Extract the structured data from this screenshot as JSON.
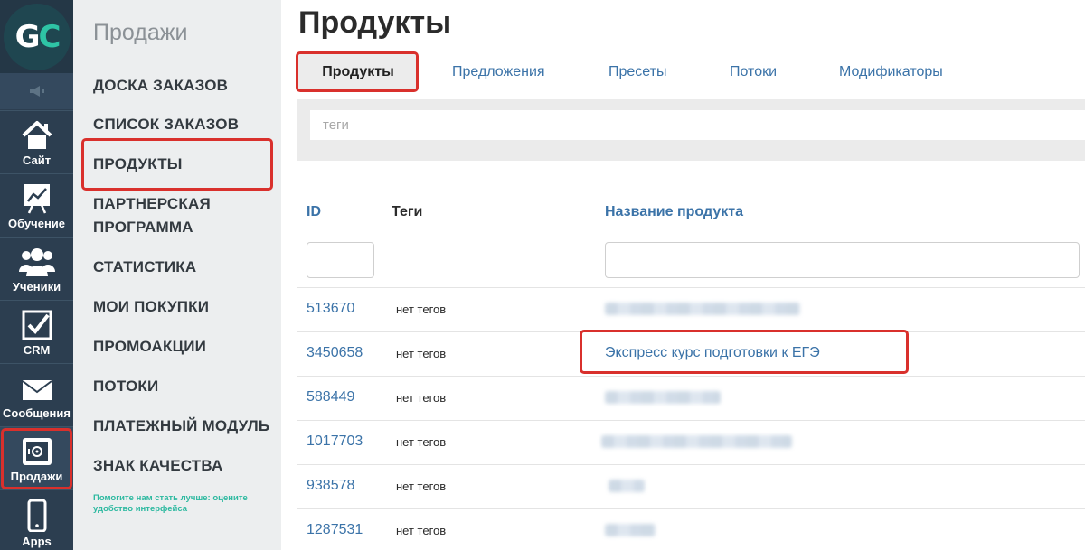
{
  "logo": {
    "g": "G",
    "c": "C"
  },
  "rail": [
    {
      "label": "Сайт",
      "icon": "home-icon"
    },
    {
      "label": "Обучение",
      "icon": "chart-board-icon"
    },
    {
      "label": "Ученики",
      "icon": "users-icon"
    },
    {
      "label": "CRM",
      "icon": "checkbox-icon"
    },
    {
      "label": "Сообщения",
      "icon": "envelope-icon"
    },
    {
      "label": "Продажи",
      "icon": "safe-icon",
      "active": true
    },
    {
      "label": "Apps",
      "icon": "phone-icon"
    }
  ],
  "menu": {
    "title": "Продажи",
    "items": [
      "ДОСКА ЗАКАЗОВ",
      "СПИСОК ЗАКАЗОВ",
      "ПРОДУКТЫ",
      "ПАРТНЕРСКАЯ ПРОГРАММА",
      "СТАТИСТИКА",
      "МОИ ПОКУПКИ",
      "ПРОМОАКЦИИ",
      "ПОТОКИ",
      "ПЛАТЕЖНЫЙ МОДУЛЬ",
      "ЗНАК КАЧЕСТВА"
    ],
    "feedback": "Помогите нам стать лучше: оцените удобство интерфейса"
  },
  "main": {
    "title": "Продукты",
    "tabs": [
      "Продукты",
      "Предложения",
      "Пресеты",
      "Потоки",
      "Модификаторы"
    ],
    "tags_placeholder": "теги",
    "columns": {
      "id": "ID",
      "tags": "Теги",
      "name": "Название продукта"
    },
    "rows": [
      {
        "id": "513670",
        "tags": "нет тегов",
        "name": ""
      },
      {
        "id": "3450658",
        "tags": "нет тегов",
        "name": "Экспресс курс подготовки к ЕГЭ"
      },
      {
        "id": "588449",
        "tags": "нет тегов",
        "name": ""
      },
      {
        "id": "1017703",
        "tags": "нет тегов",
        "name": ""
      },
      {
        "id": "938578",
        "tags": "нет тегов",
        "name": ""
      },
      {
        "id": "1287531",
        "tags": "нет тегов",
        "name": ""
      }
    ]
  },
  "colors": {
    "rail": "#2c3e50",
    "menu": "#eceeef",
    "link": "#3b73a8",
    "highlight": "#d9302c",
    "accent": "#2ec4a5"
  }
}
